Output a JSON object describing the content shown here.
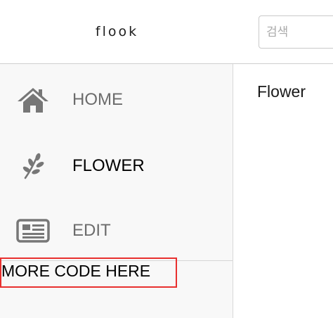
{
  "header": {
    "brand": "flook",
    "search": {
      "value": "",
      "placeholder": "검색"
    }
  },
  "sidebar": {
    "items": [
      {
        "label": "HOME",
        "icon": "home-icon",
        "active": false
      },
      {
        "label": "FLOWER",
        "icon": "leaf-icon",
        "active": true
      },
      {
        "label": "EDIT",
        "icon": "newspaper-icon",
        "active": false
      }
    ],
    "more_code": "MORE CODE HERE"
  },
  "main": {
    "title": "Flower"
  },
  "colors": {
    "sidebar_bg": "#f8f8f8",
    "icon": "#777777",
    "inactive_label": "#6c6c6c",
    "active_label": "#000000",
    "annotation_border": "#e8302f"
  }
}
